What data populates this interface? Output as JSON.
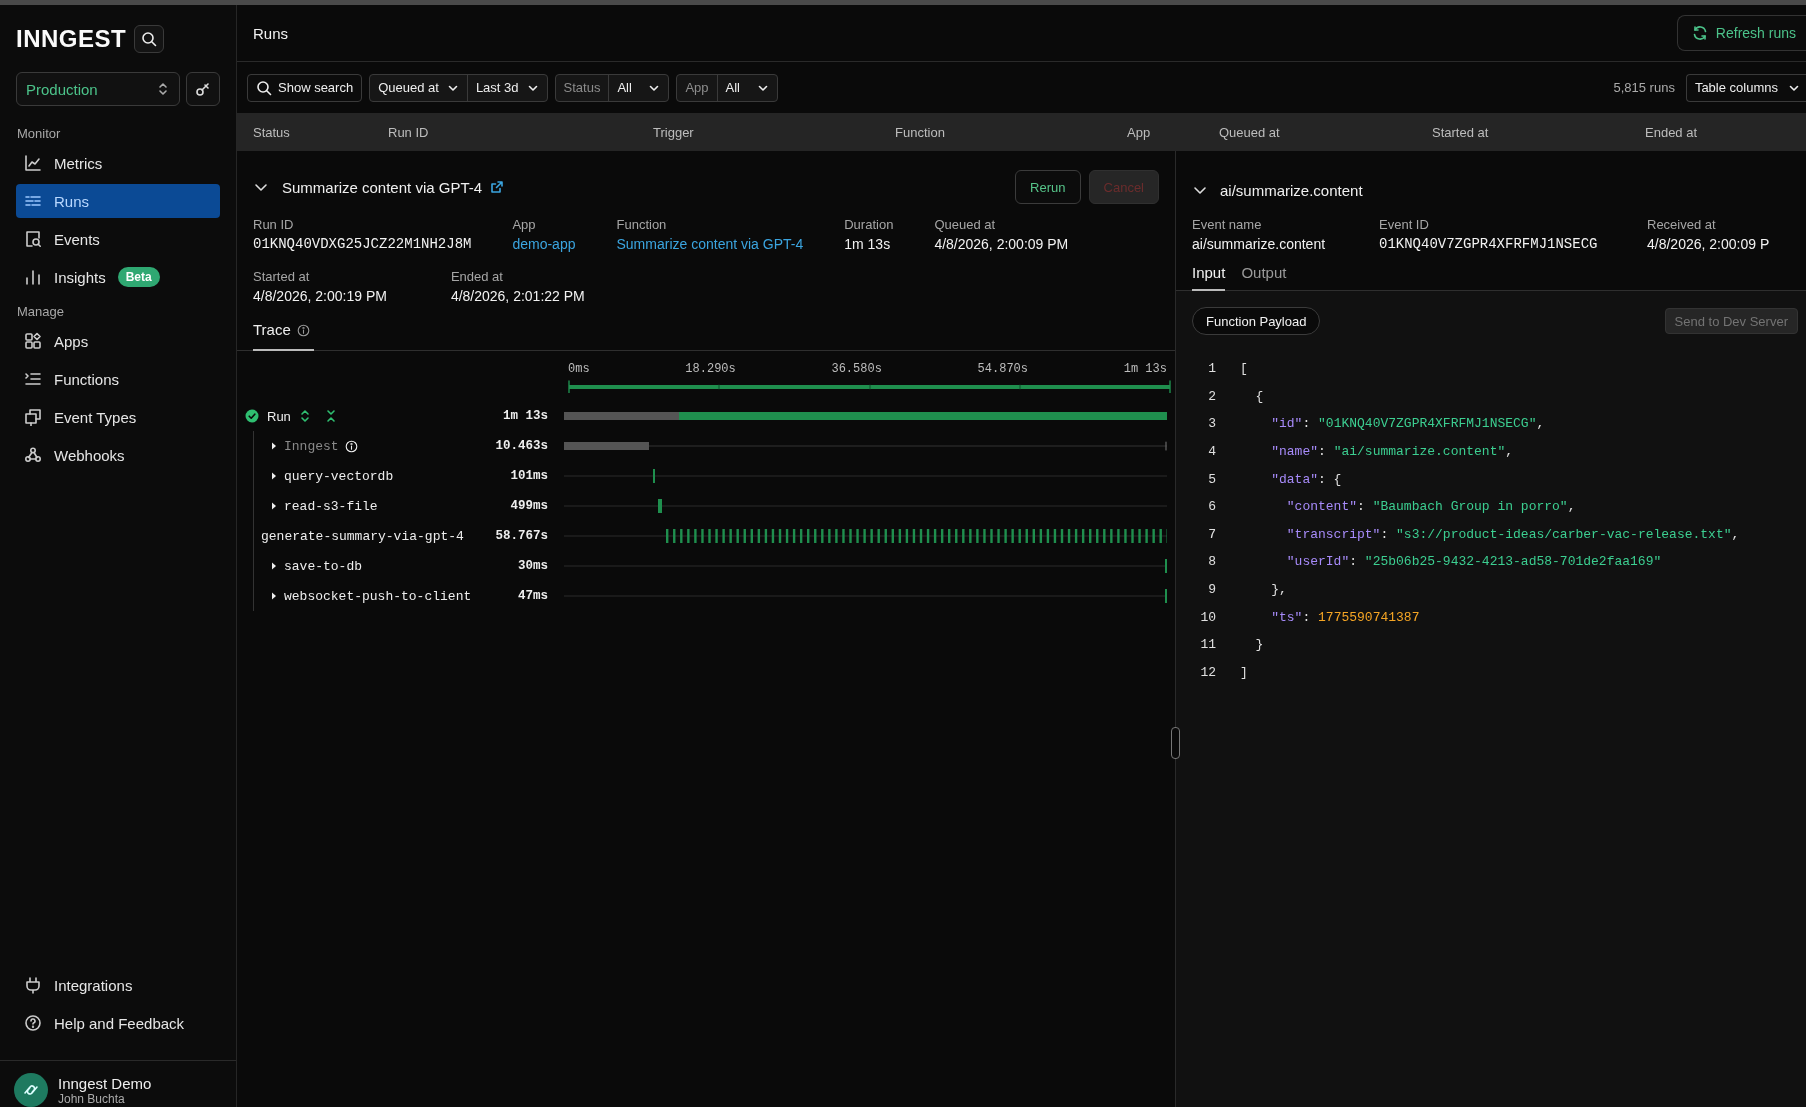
{
  "sidebar": {
    "logo": "INNGEST",
    "environment": "Production",
    "sections": [
      {
        "heading": "Monitor",
        "items": [
          {
            "label": "Metrics",
            "selected": false
          },
          {
            "label": "Runs",
            "selected": true
          },
          {
            "label": "Events",
            "selected": false
          },
          {
            "label": "Insights",
            "selected": false,
            "badge": "Beta"
          }
        ]
      },
      {
        "heading": "Manage",
        "items": [
          {
            "label": "Apps",
            "selected": false
          },
          {
            "label": "Functions",
            "selected": false
          },
          {
            "label": "Event Types",
            "selected": false
          },
          {
            "label": "Webhooks",
            "selected": false
          }
        ]
      }
    ],
    "footer_items": [
      {
        "label": "Integrations"
      },
      {
        "label": "Help and Feedback"
      }
    ],
    "account": {
      "org": "Inngest Demo",
      "user": "John Buchta"
    }
  },
  "header": {
    "title": "Runs",
    "refresh_button": "Refresh runs"
  },
  "filters": {
    "search_button": "Show search",
    "time_field": "Queued at",
    "time_range": "Last 3d",
    "status_label": "Status",
    "status_value": "All",
    "app_label": "App",
    "app_value": "All",
    "run_count": "5,815 runs",
    "columns_button": "Table columns"
  },
  "table": {
    "columns": [
      "Status",
      "Run ID",
      "Trigger",
      "Function",
      "App",
      "Queued at",
      "Started at",
      "Ended at"
    ]
  },
  "run": {
    "expanded": true,
    "title": "Summarize content via GPT-4",
    "rerun_button": "Rerun",
    "cancel_button": "Cancel",
    "cancel_disabled": true,
    "field_rows": [
      [
        {
          "label": "Run ID",
          "value": "01KNQ40VDXG25JCZ22M1NH2J8M",
          "kind": "mono"
        },
        {
          "label": "App",
          "value": "demo-app",
          "kind": "link"
        },
        {
          "label": "Function",
          "value": "Summarize content via GPT-4",
          "kind": "link"
        },
        {
          "label": "Duration",
          "value": "1m 13s",
          "kind": "text"
        },
        {
          "label": "Queued at",
          "value": "4/8/2026, 2:00:09 PM",
          "kind": "text"
        }
      ],
      [
        {
          "label": "Started at",
          "value": "4/8/2026, 2:00:19 PM",
          "kind": "text"
        },
        {
          "label": "Ended at",
          "value": "4/8/2026, 2:01:22 PM",
          "kind": "text"
        }
      ]
    ]
  },
  "trace": {
    "tab": "Trace",
    "ticks": [
      "0ms",
      "18.290s",
      "36.580s",
      "54.870s",
      "1m 13s"
    ],
    "root": {
      "name": "Run",
      "completed": true,
      "duration": "1m 13s",
      "children": [
        {
          "name": "Inngest",
          "duration": "10.463s",
          "kind": "system",
          "expandable": true
        },
        {
          "name": "query-vectordb",
          "duration": "101ms",
          "kind": "step",
          "expandable": true
        },
        {
          "name": "read-s3-file",
          "duration": "499ms",
          "kind": "step",
          "expandable": true
        },
        {
          "name": "generate-summary-via-gpt-4",
          "duration": "58.767s",
          "kind": "stream",
          "expandable": false
        },
        {
          "name": "save-to-db",
          "duration": "30ms",
          "kind": "step",
          "expandable": true
        },
        {
          "name": "websocket-push-to-client",
          "duration": "47ms",
          "kind": "step",
          "expandable": true
        }
      ]
    }
  },
  "event": {
    "expanded": true,
    "title": "ai/summarize.content",
    "fields": [
      {
        "label": "Event name",
        "value": "ai/summarize.content",
        "kind": "text"
      },
      {
        "label": "Event ID",
        "value": "01KNQ40V7ZGPR4XFRFMJ1NSECG",
        "kind": "mono"
      },
      {
        "label": "Received at",
        "value": "4/8/2026, 2:00:09 P",
        "kind": "text"
      }
    ],
    "tabs": [
      {
        "label": "Input",
        "selected": true
      },
      {
        "label": "Output",
        "selected": false
      }
    ],
    "payload_chip": "Function Payload",
    "send_button": "Send to Dev Server",
    "send_disabled": true,
    "code_lines": [
      {
        "number": "1",
        "tokens": [
          {
            "kind": "punct",
            "text": "["
          }
        ]
      },
      {
        "number": "2",
        "tokens": [
          {
            "kind": "punct",
            "text": "  {"
          }
        ]
      },
      {
        "number": "3",
        "tokens": [
          {
            "kind": "key",
            "text": "    \"id\""
          },
          {
            "kind": "punct",
            "text": ": "
          },
          {
            "kind": "string",
            "text": "\"01KNQ40V7ZGPR4XFRFMJ1NSECG\""
          },
          {
            "kind": "punct",
            "text": ","
          }
        ]
      },
      {
        "number": "4",
        "tokens": [
          {
            "kind": "key",
            "text": "    \"name\""
          },
          {
            "kind": "punct",
            "text": ": "
          },
          {
            "kind": "string",
            "text": "\"ai/summarize.content\""
          },
          {
            "kind": "punct",
            "text": ","
          }
        ]
      },
      {
        "number": "5",
        "tokens": [
          {
            "kind": "key",
            "text": "    \"data\""
          },
          {
            "kind": "punct",
            "text": ": {"
          }
        ]
      },
      {
        "number": "6",
        "tokens": [
          {
            "kind": "key",
            "text": "      \"content\""
          },
          {
            "kind": "punct",
            "text": ": "
          },
          {
            "kind": "string",
            "text": "\"Baumbach Group in porro\""
          },
          {
            "kind": "punct",
            "text": ","
          }
        ]
      },
      {
        "number": "7",
        "tokens": [
          {
            "kind": "key",
            "text": "      \"transcript\""
          },
          {
            "kind": "punct",
            "text": ": "
          },
          {
            "kind": "string",
            "text": "\"s3://product-ideas/carber-vac-release.txt\""
          },
          {
            "kind": "punct",
            "text": ","
          }
        ]
      },
      {
        "number": "8",
        "tokens": [
          {
            "kind": "key",
            "text": "      \"userId\""
          },
          {
            "kind": "punct",
            "text": ": "
          },
          {
            "kind": "string",
            "text": "\"25b06b25-9432-4213-ad58-701de2faa169\""
          }
        ]
      },
      {
        "number": "9",
        "tokens": [
          {
            "kind": "punct",
            "text": "    },"
          }
        ]
      },
      {
        "number": "10",
        "tokens": [
          {
            "kind": "key",
            "text": "    \"ts\""
          },
          {
            "kind": "punct",
            "text": ": "
          },
          {
            "kind": "number",
            "text": "1775590741387"
          }
        ]
      },
      {
        "number": "11",
        "tokens": [
          {
            "kind": "punct",
            "text": "  }"
          }
        ]
      },
      {
        "number": "12",
        "tokens": [
          {
            "kind": "punct",
            "text": "]"
          }
        ]
      }
    ]
  }
}
